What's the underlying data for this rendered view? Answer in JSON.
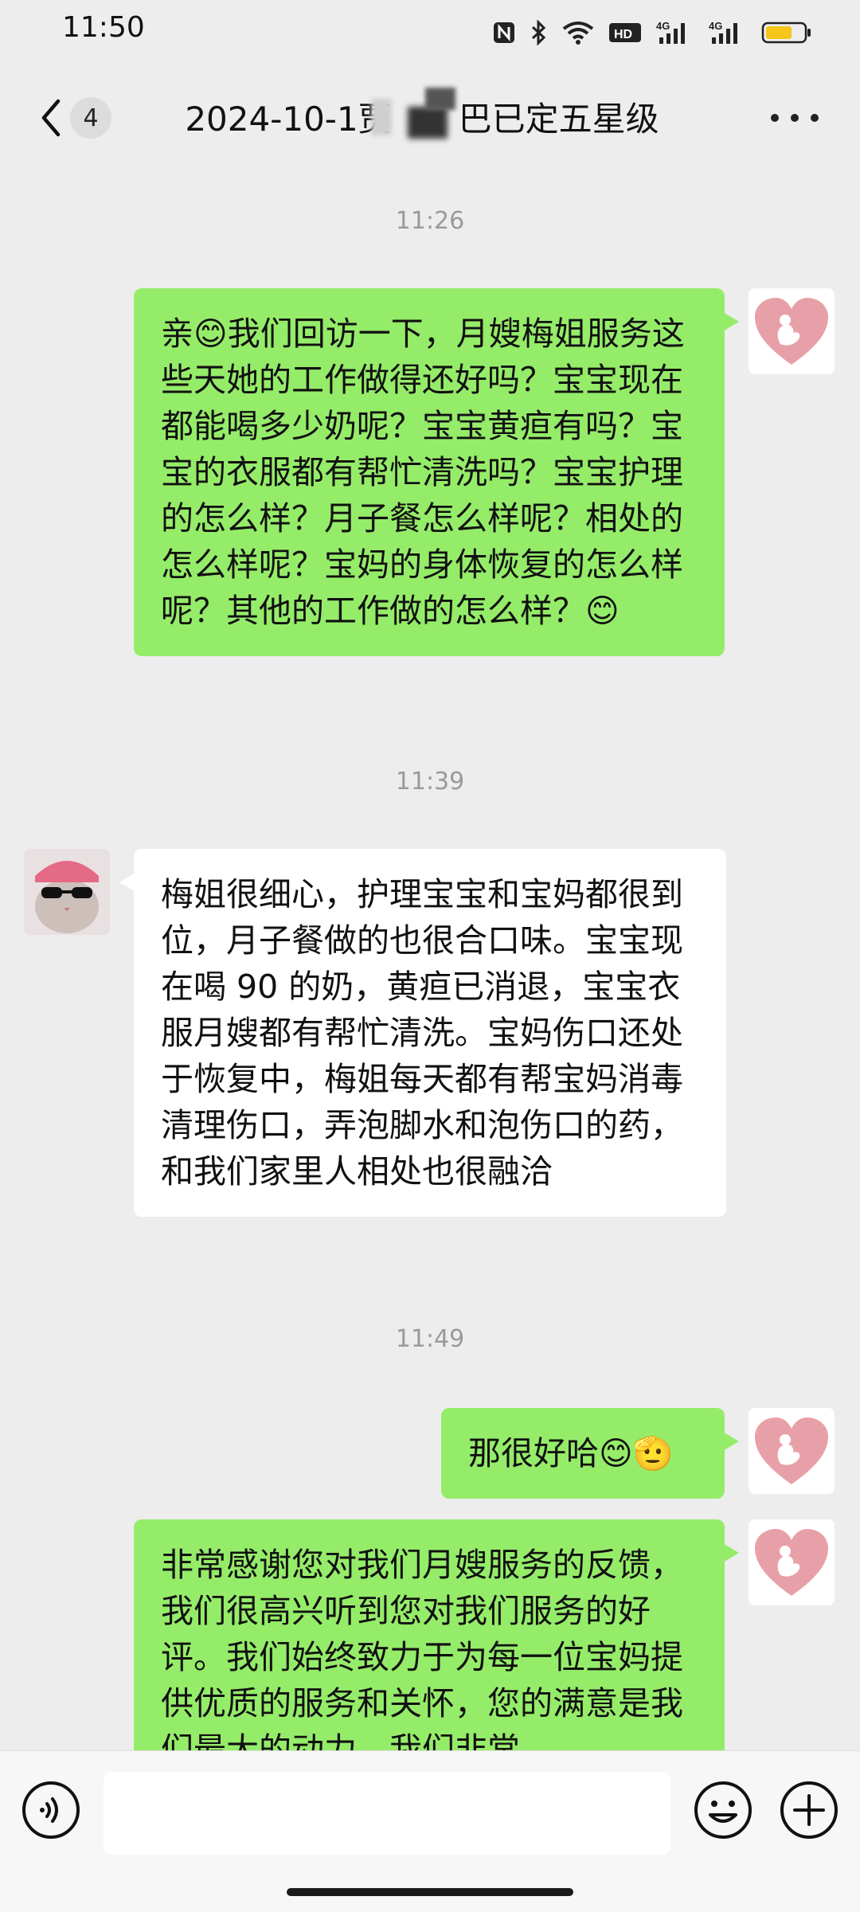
{
  "status_bar": {
    "time": "11:50",
    "network_1": "4G",
    "network_2": "4G",
    "hd_badge": "HD",
    "icons": [
      "nfc-icon",
      "bluetooth-icon",
      "wifi-icon",
      "hd-call-icon",
      "signal-4g-icon",
      "signal-4g-icon",
      "battery-icon"
    ],
    "battery_color": "#f5c518"
  },
  "header": {
    "unread_count": "4",
    "title": "2024-10-1贾　　巴已定五星级"
  },
  "messages": [
    {
      "type": "timestamp",
      "text": "11:26"
    },
    {
      "type": "outgoing",
      "text": "亲😊我们回访一下，月嫂梅姐服务这些天她的工作做得还好吗？宝宝现在都能喝多少奶呢？宝宝黄疸有吗？宝宝的衣服都有帮忙清洗吗？宝宝护理的怎么样？月子餐怎么样呢？相处的怎么样呢？宝妈的身体恢复的怎么样呢？其他的工作做的怎么样？😊"
    },
    {
      "type": "timestamp",
      "text": "11:39"
    },
    {
      "type": "incoming",
      "text": "梅姐很细心，护理宝宝和宝妈都很到位，月子餐做的也很合口味。宝宝现在喝 90 的奶，黄疸已消退，宝宝衣服月嫂都有帮忙清洗。宝妈伤口还处于恢复中，梅姐每天都有帮宝妈消毒清理伤口，弄泡脚水和泡伤口的药，和我们家里人相处也很融洽"
    },
    {
      "type": "timestamp",
      "text": "11:49"
    },
    {
      "type": "outgoing",
      "text": "那很好哈😊🫡"
    },
    {
      "type": "outgoing",
      "text": "非常感谢您对我们月嫂服务的反馈，我们很高兴听到您对我们服务的好评。我们始终致力于为每一位宝妈提供优质的服务和关怀，您的满意是我们最大的动力，我们非常"
    }
  ],
  "input": {
    "value": ""
  },
  "icons": {
    "back": "chevron-left-icon",
    "more": "more-icon",
    "voice": "voice-icon",
    "emoji": "emoji-icon",
    "plus": "plus-icon"
  },
  "colors": {
    "outgoing_bubble": "#95ec69",
    "incoming_bubble": "#ffffff",
    "background": "#ededed",
    "brand_heart": "#e8a0a8"
  }
}
